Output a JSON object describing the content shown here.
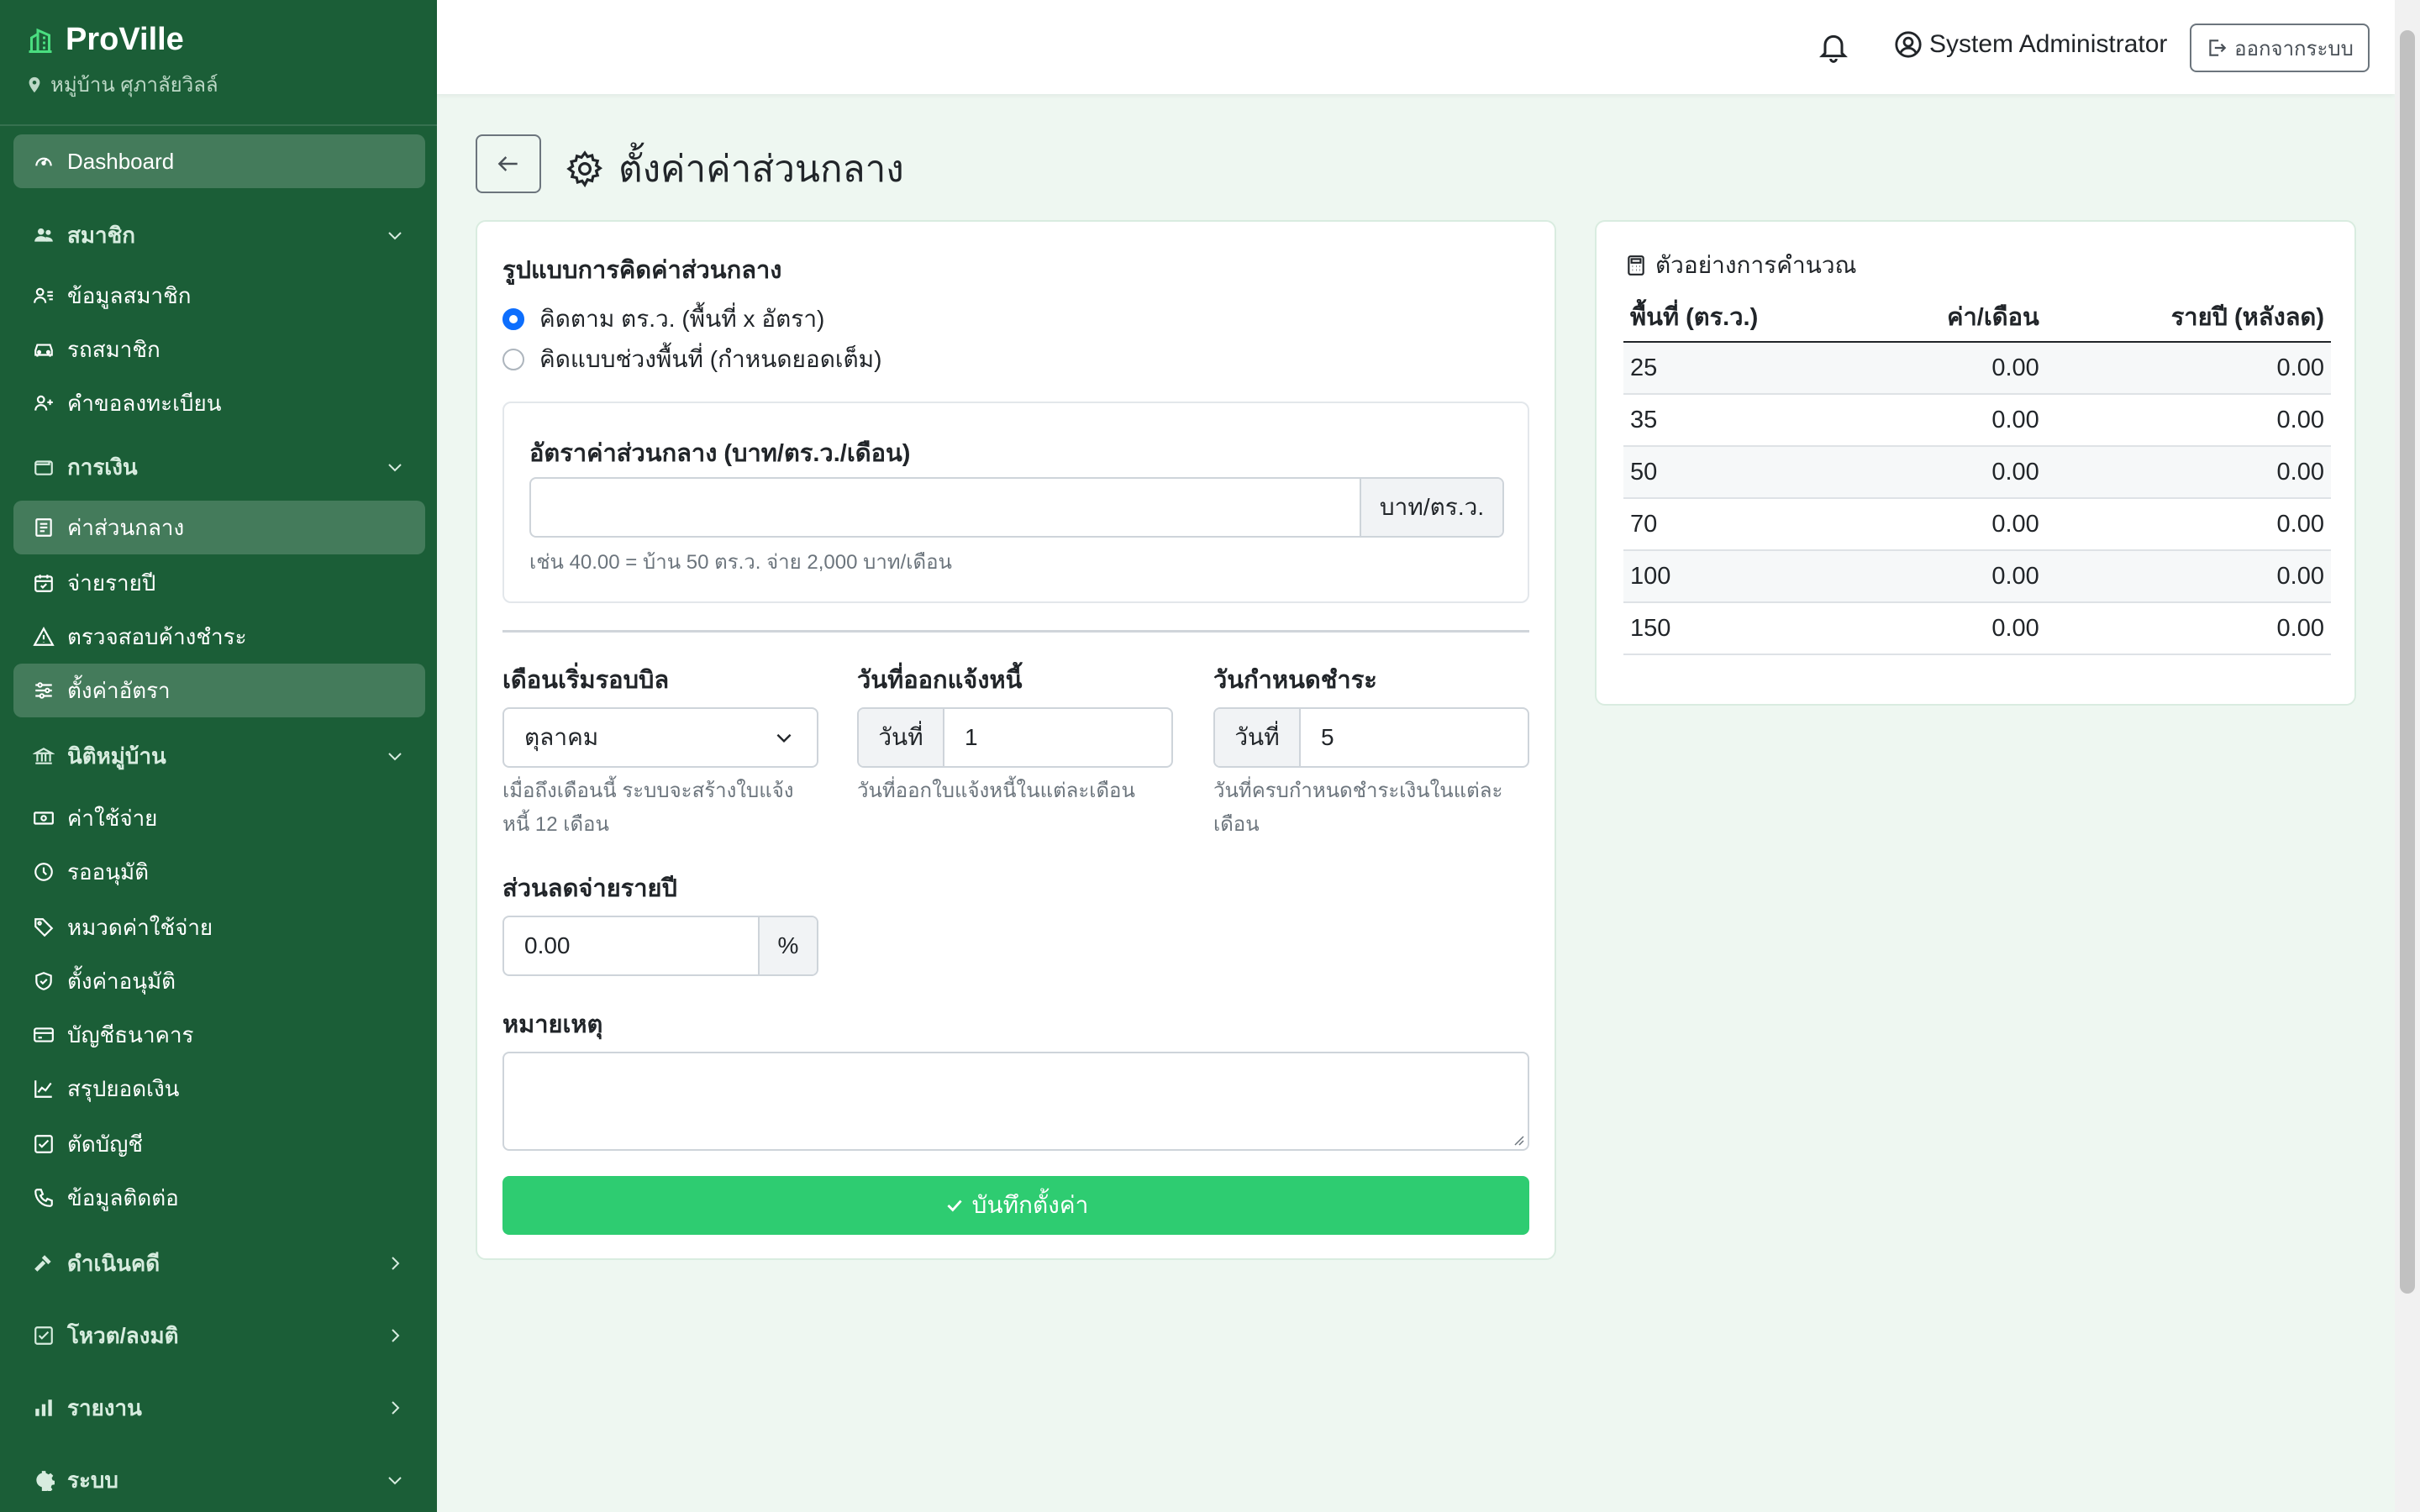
{
  "brand": {
    "name": "ProVille",
    "village": "หมู่บ้าน ศุภาลัยวิลล์"
  },
  "sidebar": {
    "dashboard": "Dashboard",
    "member_section": "สมาชิก",
    "member_info": "ข้อมูลสมาชิก",
    "member_cars": "รถสมาชิก",
    "registration_requests": "คำขอลงทะเบียน",
    "finance_section": "การเงิน",
    "common_fee": "ค่าส่วนกลาง",
    "annual_payment": "จ่ายรายปี",
    "check_overdue": "ตรวจสอบค้างชำระ",
    "rate_settings": "ตั้งค่าอัตรา",
    "juristic_section": "นิติหมู่บ้าน",
    "expenses": "ค่าใช้จ่าย",
    "pending_approval": "รออนุมัติ",
    "expense_categories": "หมวดค่าใช้จ่าย",
    "approval_settings": "ตั้งค่าอนุมัติ",
    "bank_accounts": "บัญชีธนาคาร",
    "balance_summary": "สรุปยอดเงิน",
    "bookkeeping": "ตัดบัญชี",
    "contacts": "ข้อมูลติดต่อ",
    "legal_section": "ดำเนินคดี",
    "vote_section": "โหวต/ลงมติ",
    "reports_section": "รายงาน",
    "system_section": "ระบบ"
  },
  "topbar": {
    "user_name": "System Administrator",
    "logout_label": "ออกจากระบบ"
  },
  "page": {
    "title": "ตั้งค่าค่าส่วนกลาง"
  },
  "form": {
    "calc_mode_label": "รูปแบบการคิดค่าส่วนกลาง",
    "mode_per_area": "คิดตาม ตร.ว. (พื้นที่ x อัตรา)",
    "mode_range": "คิดแบบช่วงพื้นที่ (กำหนดยอดเต็ม)",
    "selected_mode": "per_area",
    "rate_label": "อัตราค่าส่วนกลาง (บาท/ตร.ว./เดือน)",
    "rate_value": "",
    "rate_unit": "บาท/ตร.ว.",
    "rate_help": "เช่น 40.00 = บ้าน 50 ตร.ว. จ่าย 2,000 บาท/เดือน",
    "start_month_label": "เดือนเริ่มรอบบิล",
    "start_month_value": "ตุลาคม",
    "start_month_help": "เมื่อถึงเดือนนี้ ระบบจะสร้างใบแจ้งหนี้ 12 เดือน",
    "invoice_day_label": "วันที่ออกแจ้งหนี้",
    "day_prefix": "วันที่",
    "invoice_day_value": "1",
    "invoice_day_help": "วันที่ออกใบแจ้งหนี้ในแต่ละเดือน",
    "due_day_label": "วันกำหนดชำระ",
    "due_day_value": "5",
    "due_day_help": "วันที่ครบกำหนดชำระเงินในแต่ละเดือน",
    "discount_label": "ส่วนลดจ่ายรายปี",
    "discount_value": "0.00",
    "discount_unit": "%",
    "note_label": "หมายเหตุ",
    "note_value": "",
    "save_label": "บันทึกตั้งค่า"
  },
  "calc_example": {
    "title": "ตัวอย่างการคำนวณ",
    "headers": [
      "พื้นที่ (ตร.ว.)",
      "ค่า/เดือน",
      "รายปี (หลังลด)"
    ],
    "rows": [
      [
        "25",
        "0.00",
        "0.00"
      ],
      [
        "35",
        "0.00",
        "0.00"
      ],
      [
        "50",
        "0.00",
        "0.00"
      ],
      [
        "70",
        "0.00",
        "0.00"
      ],
      [
        "100",
        "0.00",
        "0.00"
      ],
      [
        "150",
        "0.00",
        "0.00"
      ]
    ]
  },
  "colors": {
    "sidebar": "#1b5e37",
    "accent_green": "#2ecc71",
    "radio_blue": "#0d6efd",
    "page_bg": "#eef7f1"
  }
}
